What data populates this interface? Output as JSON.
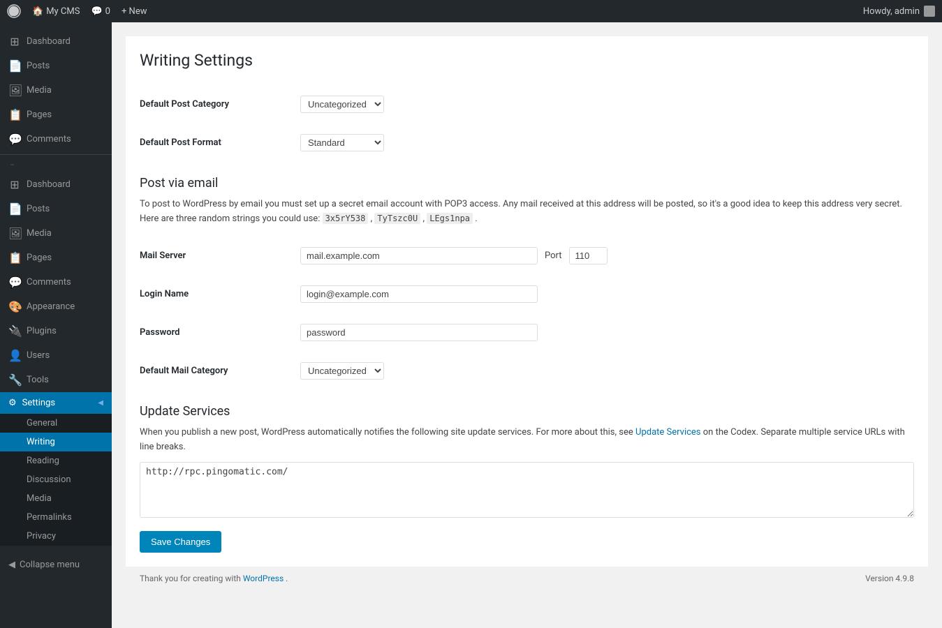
{
  "adminbar": {
    "logo": "W",
    "site_name": "My CMS",
    "comments_label": "Comments",
    "comments_count": "0",
    "new_label": "+ New",
    "howdy_text": "Howdy, admin"
  },
  "sidebar": {
    "menu_items": [
      {
        "id": "dashboard",
        "label": "Dashboard",
        "icon": "⊞"
      },
      {
        "id": "posts",
        "label": "Posts",
        "icon": "📄"
      },
      {
        "id": "media",
        "label": "Media",
        "icon": "🖼"
      },
      {
        "id": "pages",
        "label": "Pages",
        "icon": "📋"
      },
      {
        "id": "comments",
        "label": "Comments",
        "icon": "💬"
      }
    ],
    "menu_items2": [
      {
        "id": "dashboard2",
        "label": "Dashboard",
        "icon": "⊞"
      },
      {
        "id": "posts2",
        "label": "Posts",
        "icon": "📄"
      },
      {
        "id": "media2",
        "label": "Media",
        "icon": "🖼"
      },
      {
        "id": "pages2",
        "label": "Pages",
        "icon": "📋"
      },
      {
        "id": "comments2",
        "label": "Comments",
        "icon": "💬"
      },
      {
        "id": "appearance",
        "label": "Appearance",
        "icon": "🎨"
      },
      {
        "id": "plugins",
        "label": "Plugins",
        "icon": "🔌"
      },
      {
        "id": "users",
        "label": "Users",
        "icon": "👤"
      },
      {
        "id": "tools",
        "label": "Tools",
        "icon": "🔧"
      },
      {
        "id": "settings",
        "label": "Settings",
        "icon": "⚙"
      }
    ],
    "settings_submenu": [
      {
        "id": "general",
        "label": "General"
      },
      {
        "id": "writing",
        "label": "Writing",
        "active": true
      },
      {
        "id": "reading",
        "label": "Reading"
      },
      {
        "id": "discussion",
        "label": "Discussion"
      },
      {
        "id": "media",
        "label": "Media"
      },
      {
        "id": "permalinks",
        "label": "Permalinks"
      },
      {
        "id": "privacy",
        "label": "Privacy"
      }
    ],
    "collapse_label": "Collapse menu"
  },
  "page": {
    "title": "Writing Settings",
    "sections": {
      "post_via_email": {
        "title": "Post via email",
        "description": "To post to WordPress by email you must set up a secret email account with POP3 access. Any mail received at this address will be posted, so it's a good idea to keep this address very secret. Here are three random strings you could use:",
        "random_strings": [
          "3x5rY538",
          "TyTszc0U",
          "LEgs1npa"
        ]
      },
      "update_services": {
        "title": "Update Services",
        "description": "When you publish a new post, WordPress automatically notifies the following site update services. For more about this, see",
        "link_text": "Update Services",
        "description2": "on the Codex. Separate multiple service URLs with line breaks.",
        "textarea_value": "http://rpc.pingomatic.com/"
      }
    },
    "fields": {
      "default_post_category": {
        "label": "Default Post Category",
        "value": "Uncategorized"
      },
      "default_post_format": {
        "label": "Default Post Format",
        "value": "Standard"
      },
      "mail_server": {
        "label": "Mail Server",
        "value": "mail.example.com",
        "port_label": "Port",
        "port_value": "110"
      },
      "login_name": {
        "label": "Login Name",
        "value": "login@example.com"
      },
      "password": {
        "label": "Password",
        "value": "password"
      },
      "default_mail_category": {
        "label": "Default Mail Category",
        "value": "Uncategorized"
      }
    },
    "save_button": "Save Changes"
  },
  "footer": {
    "left_text": "Thank you for creating with",
    "link_text": "WordPress",
    "version": "Version 4.9.8"
  }
}
